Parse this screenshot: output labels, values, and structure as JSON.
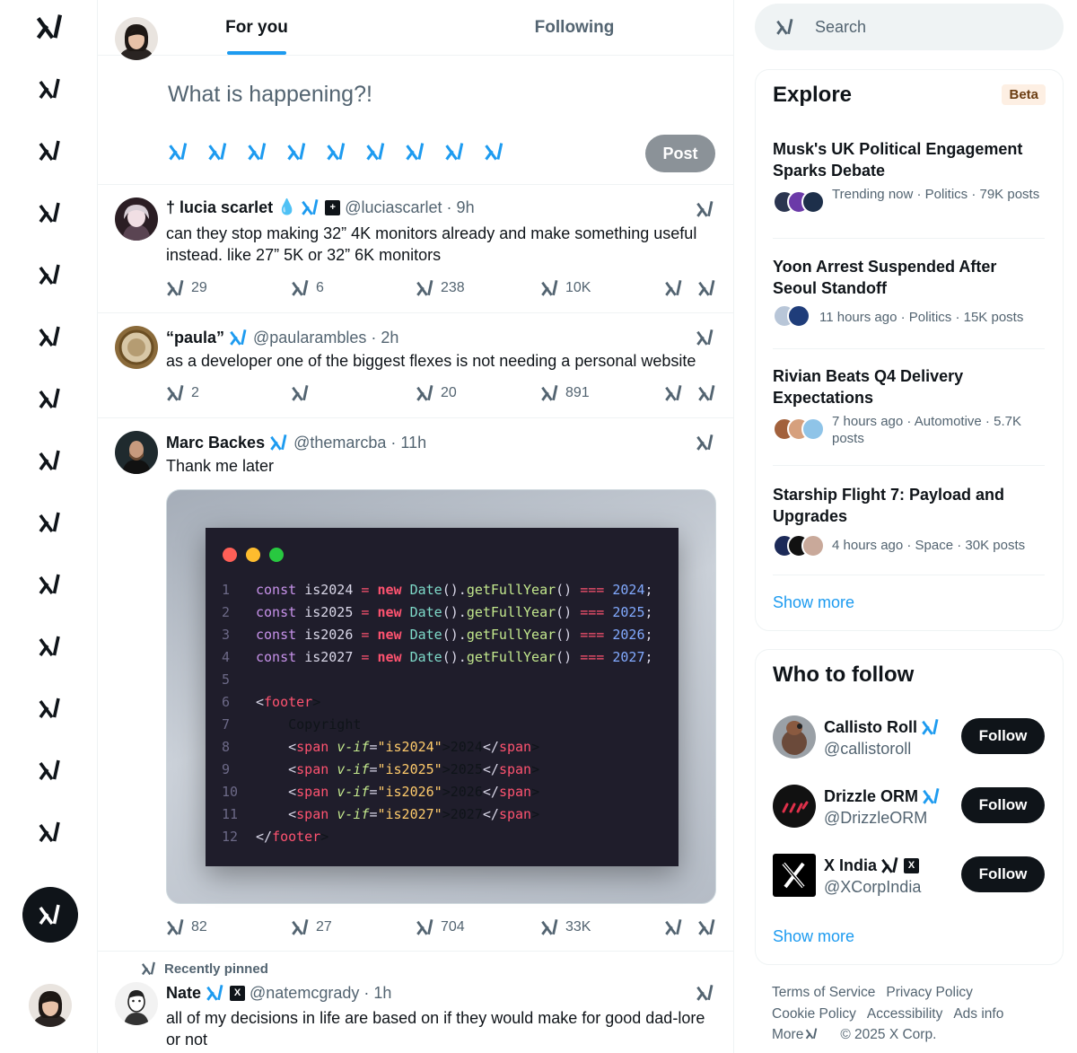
{
  "tabs": [
    {
      "label": "For you",
      "active": true
    },
    {
      "label": "Following",
      "active": false
    }
  ],
  "composer": {
    "placeholder": "What is happening?!",
    "post_label": "Post",
    "tool_icon_count": 9
  },
  "tweets": [
    {
      "name": "† lucia scarlet",
      "handle": "@luciascarlet · 9h",
      "text": "can they stop making 32” 4K monitors already and make something useful instead. like 27” 5K or 32” 6K monitors",
      "stats": {
        "replies": "29",
        "reposts": "6",
        "likes": "238",
        "views": "10K"
      }
    },
    {
      "name": "“paula”",
      "handle": "@paularambles · 2h",
      "text": "as a developer one of the biggest flexes is not needing a personal website",
      "stats": {
        "replies": "2",
        "reposts": "",
        "likes": "20",
        "views": "891"
      }
    },
    {
      "name": "Marc Backes",
      "handle": "@themarcba · 11h",
      "text": "Thank me later",
      "stats": {
        "replies": "82",
        "reposts": "27",
        "likes": "704",
        "views": "33K"
      }
    },
    {
      "pinned_label": "Recently pinned",
      "name": "Nate",
      "handle": "@natemcgrady · 1h",
      "text": "all of my decisions in life are based on if they would make for good dad-lore or not"
    }
  ],
  "code_lines": [
    "const is2024 = new Date().getFullYear() === 2024;",
    "const is2025 = new Date().getFullYear() === 2025;",
    "const is2026 = new Date().getFullYear() === 2026;",
    "const is2027 = new Date().getFullYear() === 2027;",
    "",
    "<footer>",
    "    Copyright",
    "    <span v-if=\"is2024\">2024</span>",
    "    <span v-if=\"is2025\">2025</span>",
    "    <span v-if=\"is2026\">2026</span>",
    "    <span v-if=\"is2027\">2027</span>",
    "</footer>"
  ],
  "search": {
    "placeholder": "Search"
  },
  "explore": {
    "title": "Explore",
    "badge": "Beta",
    "trends": [
      {
        "title": "Musk's UK Political Engagement Sparks Debate",
        "meta": "Trending now · Politics · 79K posts"
      },
      {
        "title": "Yoon Arrest Suspended After Seoul Standoff",
        "meta": "11 hours ago · Politics · 15K posts"
      },
      {
        "title": "Rivian Beats Q4 Delivery Expectations",
        "meta": "7 hours ago · Automotive · 5.7K posts"
      },
      {
        "title": "Starship Flight 7: Payload and Upgrades",
        "meta": "4 hours ago · Space · 30K posts"
      }
    ],
    "show_more": "Show more"
  },
  "who_to_follow": {
    "title": "Who to follow",
    "accounts": [
      {
        "name": "Callisto Roll",
        "handle": "@callistoroll",
        "button": "Follow"
      },
      {
        "name": "Drizzle ORM",
        "handle": "@DrizzleORM",
        "button": "Follow"
      },
      {
        "name": "X India",
        "handle": "@XCorpIndia",
        "button": "Follow"
      }
    ],
    "show_more": "Show more"
  },
  "footer": {
    "links": [
      "Terms of Service",
      "Privacy Policy",
      "Cookie Policy",
      "Accessibility",
      "Ads info",
      "More"
    ],
    "copyright": "© 2025 X Corp."
  },
  "colors": {
    "accent": "#1d9bf0",
    "text": "#0f1419",
    "muted": "#536471",
    "post_disabled": "#8b9298"
  },
  "icons": {
    "placeholder_glyph": "xai-logo-icon"
  }
}
